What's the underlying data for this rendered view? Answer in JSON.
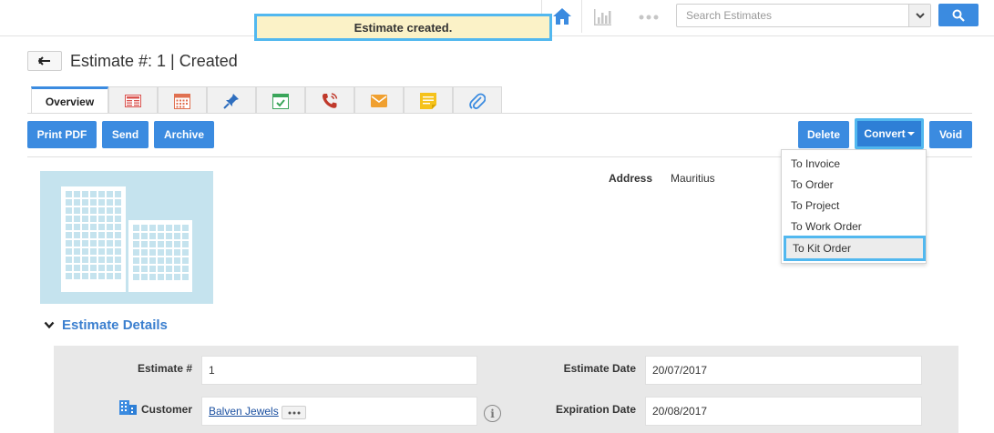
{
  "search": {
    "placeholder": "Search Estimates"
  },
  "toast": {
    "message": "Estimate created."
  },
  "header": {
    "title": "Estimate #: 1 | Created"
  },
  "tabs": [
    {
      "label": "Overview",
      "icon": "overview"
    },
    {
      "label": "",
      "icon": "details-list-icon"
    },
    {
      "label": "",
      "icon": "calendar-icon"
    },
    {
      "label": "",
      "icon": "pin-icon"
    },
    {
      "label": "",
      "icon": "task-check-icon"
    },
    {
      "label": "",
      "icon": "phone-call-icon"
    },
    {
      "label": "",
      "icon": "email-icon"
    },
    {
      "label": "",
      "icon": "sticky-note-icon"
    },
    {
      "label": "",
      "icon": "attachment-icon"
    }
  ],
  "actions": {
    "print_pdf": "Print PDF",
    "send": "Send",
    "archive": "Archive",
    "delete": "Delete",
    "convert": "Convert",
    "void": "Void"
  },
  "convert_menu": [
    "To Invoice",
    "To Order",
    "To Project",
    "To Work Order",
    "To Kit Order"
  ],
  "address": {
    "label": "Address",
    "value": "Mauritius"
  },
  "section": {
    "title": "Estimate Details"
  },
  "fields": {
    "estimate_no": {
      "label": "Estimate #",
      "value": "1"
    },
    "customer": {
      "label": "Customer",
      "value": "Balven Jewels"
    },
    "estimate_date": {
      "label": "Estimate Date",
      "value": "20/07/2017"
    },
    "expiration_date": {
      "label": "Expiration Date",
      "value": "20/08/2017"
    }
  },
  "colors": {
    "accent": "#3b8be0",
    "highlight": "#52b8ef",
    "toast_bg": "#fbf2c7",
    "section_title": "#3b7fcf"
  }
}
